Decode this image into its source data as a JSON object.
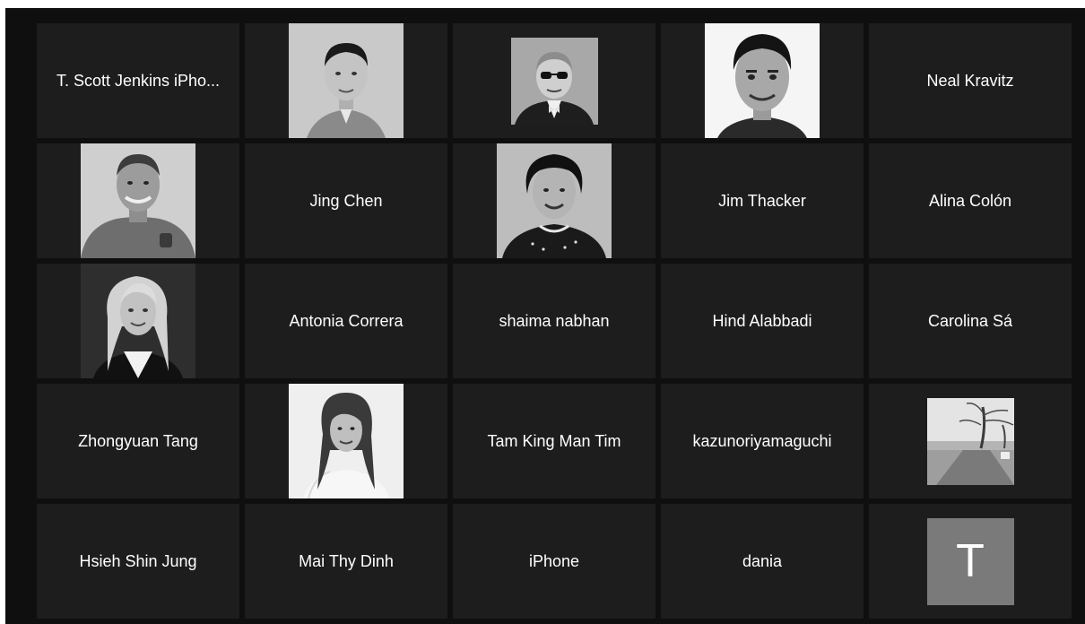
{
  "participants": [
    {
      "name": "T. Scott Jenkins iPho...",
      "photo": false
    },
    {
      "name": "",
      "photo": true,
      "photo_desc": "man-portrait-icon"
    },
    {
      "name": "",
      "photo": true,
      "photo_desc": "man-glasses-portrait-icon"
    },
    {
      "name": "",
      "photo": true,
      "photo_desc": "man-smiling-portrait-icon"
    },
    {
      "name": "Neal Kravitz",
      "photo": false
    },
    {
      "name": "",
      "photo": true,
      "photo_desc": "man-older-portrait-icon"
    },
    {
      "name": "Jing Chen",
      "photo": false
    },
    {
      "name": "",
      "photo": true,
      "photo_desc": "woman-older-portrait-icon"
    },
    {
      "name": "Jim Thacker",
      "photo": false
    },
    {
      "name": "Alina Colón",
      "photo": false
    },
    {
      "name": "",
      "photo": true,
      "photo_desc": "woman-blonde-portrait-icon"
    },
    {
      "name": "Antonia Correra",
      "photo": false
    },
    {
      "name": "shaima nabhan",
      "photo": false
    },
    {
      "name": "Hind Alabbadi",
      "photo": false
    },
    {
      "name": "Carolina Sá",
      "photo": false
    },
    {
      "name": "Zhongyuan Tang",
      "photo": false
    },
    {
      "name": "",
      "photo": true,
      "photo_desc": "woman-portrait-icon"
    },
    {
      "name": "Tam King Man Tim",
      "photo": false
    },
    {
      "name": "kazunoriyamaguchi",
      "photo": false
    },
    {
      "name": "",
      "photo": true,
      "photo_desc": "landscape-pier-icon"
    },
    {
      "name": "Hsieh Shin Jung",
      "photo": false
    },
    {
      "name": "Mai Thy Dinh",
      "photo": false
    },
    {
      "name": "iPhone",
      "photo": false
    },
    {
      "name": "dania",
      "photo": false
    },
    {
      "name": "",
      "photo": false,
      "avatar_letter": "T"
    }
  ],
  "colors": {
    "background": "#0f0f0f",
    "tile": "#1d1d1d",
    "text": "#ffffff",
    "avatar_bg": "#7a7a7a"
  }
}
